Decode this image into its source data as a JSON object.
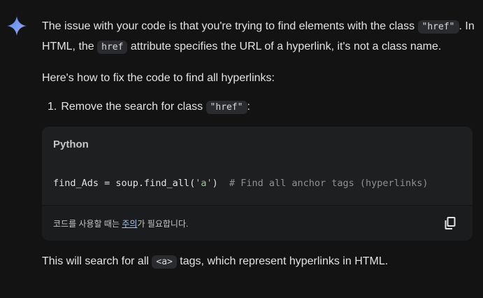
{
  "message": {
    "p1": {
      "t1": "The issue with your code is that you're trying to find elements with the class ",
      "code1": "\"href\"",
      "t2": ". In HTML, the ",
      "code2": "href",
      "t3": " attribute specifies the URL of a hyperlink, it's not a class name."
    },
    "p2": "Here's how to fix the code to find all hyperlinks:",
    "list": [
      {
        "number": "1.",
        "t1": "Remove the search for class ",
        "code": "\"href\"",
        "t2": ":"
      }
    ],
    "code_block": {
      "language": "Python",
      "code": {
        "pre": "find_Ads = soup.find_all(",
        "str": "'a'",
        "post": ")  ",
        "comment": "# Find all anchor tags (hyperlinks)"
      },
      "footer": {
        "pre": "코드를 사용할 때는 ",
        "link": "주의",
        "post": "가 필요합니다."
      },
      "copy_icon": "copy-icon"
    },
    "p3": {
      "t1": "This will search for all ",
      "code": "<a>",
      "t2": " tags, which represent hyperlinks in HTML."
    }
  },
  "colors": {
    "background": "#131314",
    "code_block": "#1e1f20",
    "link": "#a8c7fa",
    "string": "#9ccc82",
    "comment": "#8e9194"
  },
  "icons": {
    "avatar": "gemini-sparkle-icon",
    "copy": "copy-icon"
  }
}
